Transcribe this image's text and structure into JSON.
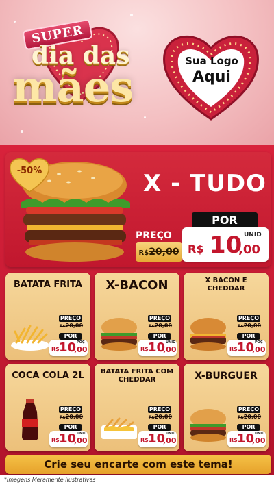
{
  "header": {
    "super_label": "SUPER",
    "title_line1": "dia das",
    "title_line2": "mães",
    "brand_line1": "Sua Logo",
    "brand_line2": "Aqui"
  },
  "hero": {
    "discount": "-50%",
    "name": "X - TUDO",
    "preco_label": "PREÇO",
    "old_currency": "R$",
    "old_price": "20,00",
    "por_label": "POR",
    "new_currency": "R$",
    "new_int": "10",
    "new_cents": ",00",
    "unid": "UNID"
  },
  "products": [
    {
      "name": "BATATA FRITA",
      "preco_label": "PREÇO",
      "old_currency": "R$",
      "old_price": "20,00",
      "por_label": "POR",
      "new_currency": "R$",
      "new_int": "10",
      "new_cents": ",00",
      "unid": "POÇ",
      "icon": "fries-icon"
    },
    {
      "name": "X-BACON",
      "preco_label": "PREÇO",
      "old_currency": "R$",
      "old_price": "20,00",
      "por_label": "POR",
      "new_currency": "R$",
      "new_int": "10",
      "new_cents": ",00",
      "unid": "UNID",
      "icon": "burger-icon"
    },
    {
      "name": "X BACON E CHEDDAR",
      "preco_label": "PREÇO",
      "old_currency": "R$",
      "old_price": "20,00",
      "por_label": "POR",
      "new_currency": "R$",
      "new_int": "10",
      "new_cents": ",00",
      "unid": "POÇ",
      "icon": "cheddar-burger-icon"
    },
    {
      "name": "COCA COLA 2L",
      "preco_label": "PREÇO",
      "old_currency": "R$",
      "old_price": "20,00",
      "por_label": "POR",
      "new_currency": "R$",
      "new_int": "10",
      "new_cents": ",00",
      "unid": "UNID",
      "icon": "soda-bottle-icon"
    },
    {
      "name": "BATATA FRITA COM CHEDDAR",
      "preco_label": "PREÇO",
      "old_currency": "R$",
      "old_price": "20,00",
      "por_label": "POR",
      "new_currency": "R$",
      "new_int": "10",
      "new_cents": ",00",
      "unid": "UNID",
      "icon": "cheddar-fries-icon"
    },
    {
      "name": "X-BURGUER",
      "preco_label": "PREÇO",
      "old_currency": "R$",
      "old_price": "20,00",
      "por_label": "POR",
      "new_currency": "R$",
      "new_int": "10",
      "new_cents": ",00",
      "unid": "UNID",
      "icon": "burger-icon"
    }
  ],
  "cta": "Crie seu encarte com este tema!",
  "footer_note": "*Imagens Meramente Ilustrativas",
  "colors": {
    "accent_red": "#c91c35",
    "gold": "#f5c247",
    "card": "#f6d79b"
  }
}
